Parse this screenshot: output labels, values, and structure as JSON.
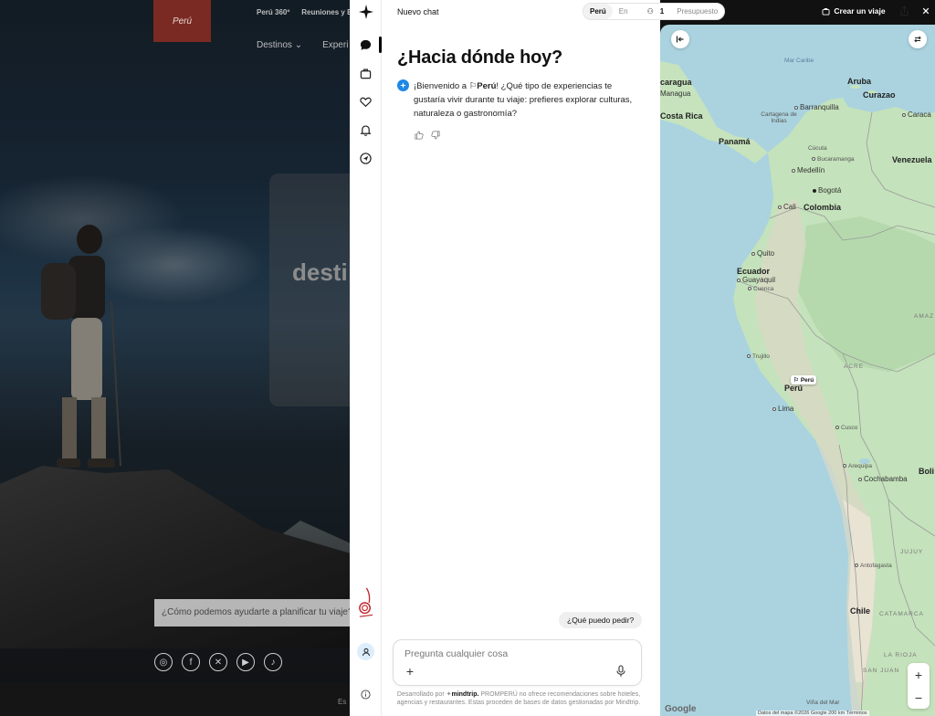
{
  "background_site": {
    "logo_text": "Perú",
    "top_nav": [
      "Perú 360º",
      "Reuniones y E"
    ],
    "main_nav": [
      "Destinos",
      "Experi"
    ],
    "hero_text": "desti",
    "search_prompt": "¿Cómo podemos ayudarte a planificar tu viaje?",
    "footer_text": "Es",
    "social_icons": [
      "instagram-icon",
      "facebook-icon",
      "x-icon",
      "youtube-icon",
      "tiktok-icon"
    ],
    "vertical_logo": "Perú"
  },
  "rail": {
    "items": [
      "sparkle-icon",
      "chat-icon",
      "suitcase-icon",
      "heart-icon",
      "bell-icon",
      "send-icon"
    ],
    "bottom": [
      "avatar-icon",
      "info-icon"
    ]
  },
  "header": {
    "chat_title": "Nuevo chat",
    "destination": "Perú",
    "dates": "En",
    "travelers": "1",
    "budget": "Presupuesto",
    "create_trip": "Crear un viaje"
  },
  "chat": {
    "heading": "¿Hacia dónde hoy?",
    "message_prefix": "¡Bienvenido a",
    "message_place": "Perú",
    "message_rest": "! ¿Qué tipo de experiencias te gustaría vivir durante tu viaje: prefieres explorar culturas, naturaleza o gastronomía?",
    "suggestion": "¿Qué puedo pedir?",
    "input_placeholder": "Pregunta cualquier cosa",
    "disclaimer_prefix": "Desarrollado por",
    "disclaimer_brand": "mindtrip.",
    "disclaimer_rest": "PROMPERÚ no ofrece recomendaciones sobre hoteles, agencias y restaurantes. Estas proceden de bases de datos gestionadas por Mindtrip."
  },
  "map": {
    "sea_label": "Mar Caribe",
    "labels": {
      "nicaragua": "caragua",
      "managua": "Managua",
      "costa_rica": "Costa Rica",
      "aruba": "Aruba",
      "curazao": "Curazao",
      "caracas": "Caraca",
      "barranquilla": "Barranquilla",
      "cartagena": "Cartagena de Indias",
      "panama": "Panamá",
      "cucuta": "Cúcuta",
      "bucaramanga": "Bucaramanga",
      "venezuela": "Venezuela",
      "medellin": "Medellín",
      "bogota": "Bogotá",
      "cali": "Cali",
      "colombia": "Colombia",
      "quito": "Quito",
      "ecuador": "Ecuador",
      "guayaquil": "Guayaquil",
      "cuenca": "Cuenca",
      "amazonas": "AMAZ",
      "trujillo": "Trujillo",
      "acre": "ACRE",
      "peru": "Perú",
      "lima": "Lima",
      "cusco": "Cusco",
      "arequipa": "Arequipa",
      "bolivia": "Boli",
      "cochabamba": "Cochabamba",
      "jujuy": "JUJUY",
      "antofagasta": "Antofagasta",
      "chile": "Chile",
      "catamarca": "CATAMARCA",
      "la_rioja": "LA RIOJA",
      "san_juan": "SAN JUAN",
      "vina_del_mar": "Viña del Mar"
    },
    "pin_label": "Perú",
    "google": "Google",
    "attribution": "Datos del mapa ©2026 Google   200 km       Términos",
    "zoom_in": "+",
    "zoom_out": "−"
  }
}
